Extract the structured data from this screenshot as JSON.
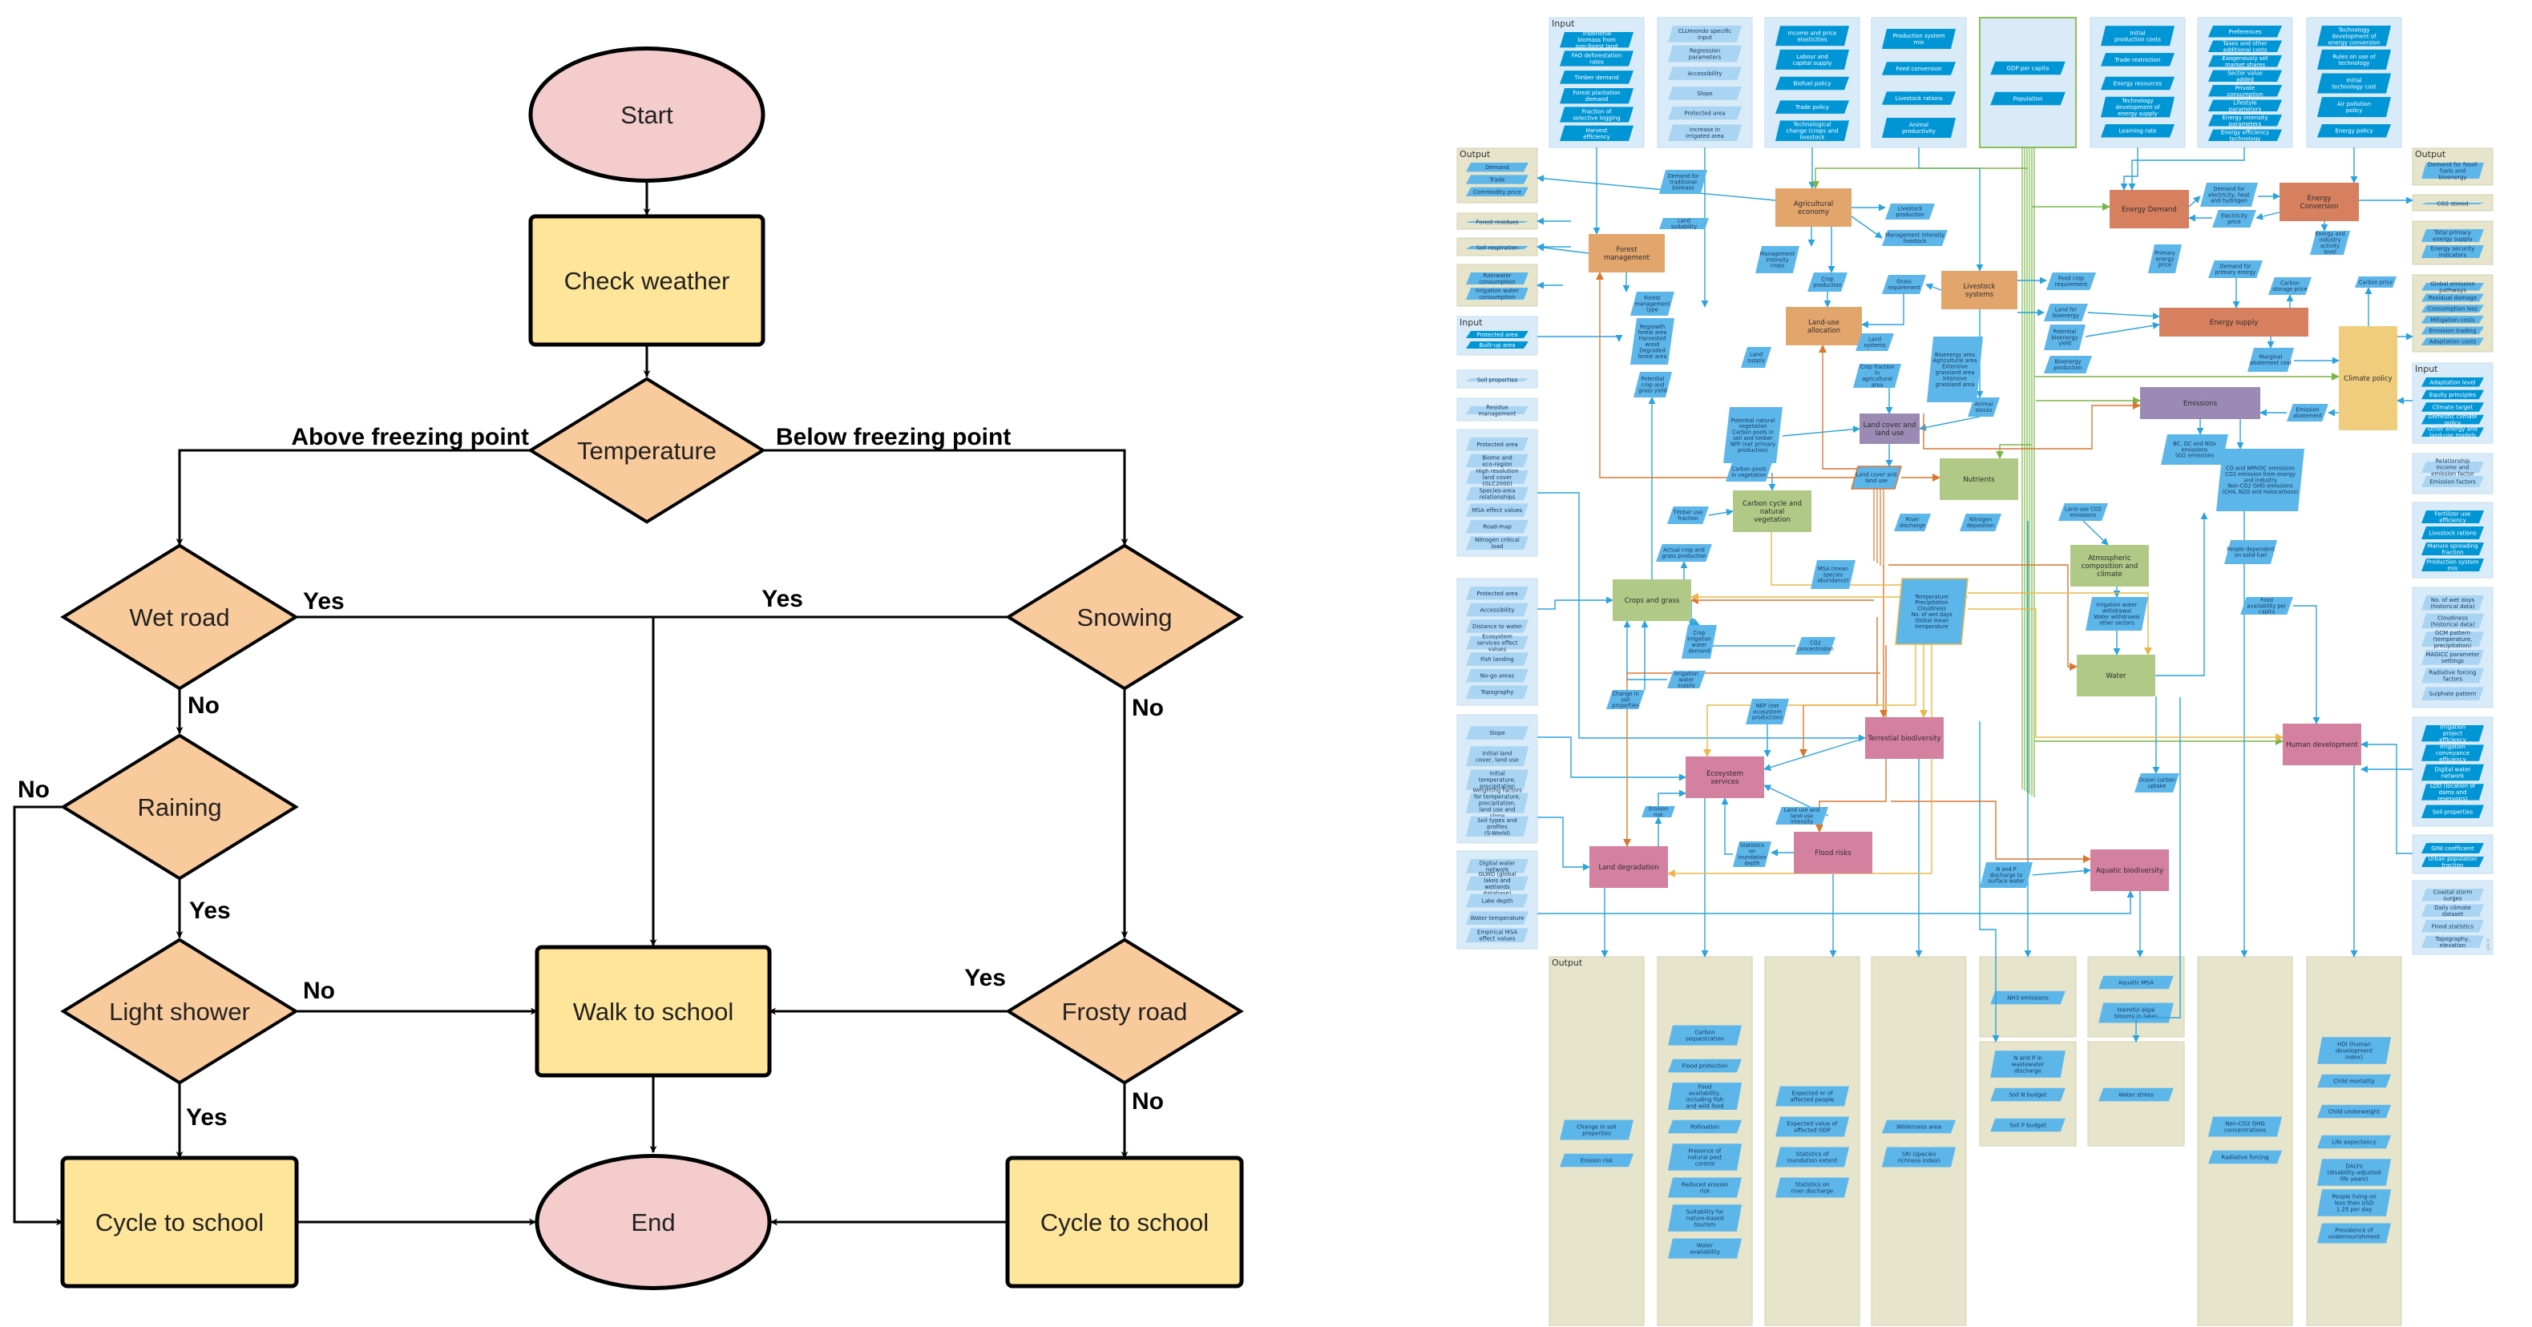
{
  "flowchart": {
    "colors": {
      "terminal": "#f4cccc",
      "process": "#ffe599",
      "decision": "#f9cb9c",
      "stroke": "#000000"
    },
    "nodes": [
      {
        "id": "start",
        "type": "terminal",
        "label": "Start"
      },
      {
        "id": "check_weather",
        "type": "process",
        "label": "Check weather"
      },
      {
        "id": "temperature",
        "type": "decision",
        "label": "Temperature"
      },
      {
        "id": "wet_road",
        "type": "decision",
        "label": "Wet road"
      },
      {
        "id": "snowing",
        "type": "decision",
        "label": "Snowing"
      },
      {
        "id": "raining",
        "type": "decision",
        "label": "Raining"
      },
      {
        "id": "light_shower",
        "type": "decision",
        "label": "Light shower"
      },
      {
        "id": "walk_to_school",
        "type": "process",
        "label": "Walk to school"
      },
      {
        "id": "frosty_road",
        "type": "decision",
        "label": "Frosty road"
      },
      {
        "id": "cycle_left",
        "type": "process",
        "label": "Cycle to school"
      },
      {
        "id": "end",
        "type": "terminal",
        "label": "End"
      },
      {
        "id": "cycle_right",
        "type": "process",
        "label": "Cycle to school"
      }
    ],
    "edges": [
      {
        "from": "start",
        "to": "check_weather",
        "label": ""
      },
      {
        "from": "check_weather",
        "to": "temperature",
        "label": ""
      },
      {
        "from": "temperature",
        "to": "wet_road",
        "label": "Above freezing point"
      },
      {
        "from": "temperature",
        "to": "snowing",
        "label": "Below freezing point"
      },
      {
        "from": "wet_road",
        "to": "walk_to_school",
        "label": "Yes"
      },
      {
        "from": "snowing",
        "to": "walk_to_school",
        "label": "Yes"
      },
      {
        "from": "wet_road",
        "to": "raining",
        "label": "No"
      },
      {
        "from": "snowing",
        "to": "frosty_road",
        "label": "No"
      },
      {
        "from": "raining",
        "to": "cycle_left",
        "label": "No"
      },
      {
        "from": "raining",
        "to": "light_shower",
        "label": "Yes"
      },
      {
        "from": "light_shower",
        "to": "walk_to_school",
        "label": "No"
      },
      {
        "from": "light_shower",
        "to": "cycle_left",
        "label": "Yes"
      },
      {
        "from": "frosty_road",
        "to": "walk_to_school",
        "label": "Yes"
      },
      {
        "from": "frosty_road",
        "to": "cycle_right",
        "label": "No"
      },
      {
        "from": "walk_to_school",
        "to": "end",
        "label": ""
      },
      {
        "from": "cycle_left",
        "to": "end",
        "label": ""
      },
      {
        "from": "cycle_right",
        "to": "end",
        "label": ""
      }
    ]
  },
  "framework": {
    "colors": {
      "input_panel": "#d9ebf8",
      "output_panel": "#e6e4cb",
      "param_dark": "#0096d6",
      "param_mid": "#5db6ea",
      "param_light": "#a9d4f2",
      "arrow": "#2aa3df",
      "agri": "#e2a56c",
      "energy": "#d6805f",
      "emissions": "#9b8bb4",
      "earth_system": "#b0c986",
      "impacts": "#d4809f",
      "climate_policy": "#f0cd7c",
      "drivers_border": "#8cbd5a",
      "orange_flow": "#d9772f",
      "yellow_flow": "#eab84a",
      "green_flow": "#7ab648"
    },
    "panel_titles": {
      "input": "Input",
      "output": "Output"
    },
    "watermark": "pbl.nl",
    "core_modules": [
      {
        "id": "agricultural_economy",
        "label": "Agricultural economy",
        "group": "agri"
      },
      {
        "id": "forest_management",
        "label": "Forest management",
        "group": "agri"
      },
      {
        "id": "livestock_systems",
        "label": "Livestock systems",
        "group": "agri"
      },
      {
        "id": "land_use_allocation",
        "label": "Land-use allocation",
        "group": "agri"
      },
      {
        "id": "energy_demand",
        "label": "Energy Demand",
        "group": "energy"
      },
      {
        "id": "energy_conversion",
        "label": "Energy Conversion",
        "group": "energy"
      },
      {
        "id": "energy_supply",
        "label": "Energy supply",
        "group": "energy"
      },
      {
        "id": "climate_policy",
        "label": "Climate policy",
        "group": "climate_policy"
      },
      {
        "id": "emissions",
        "label": "Emissions",
        "group": "emissions"
      },
      {
        "id": "land_cover_land_use",
        "label": "Land cover and land use",
        "group": "emissions"
      },
      {
        "id": "nutrients",
        "label": "Nutrients",
        "group": "earth_system"
      },
      {
        "id": "carbon_cycle",
        "label": "Carbon cycle and natural vegetation",
        "group": "earth_system"
      },
      {
        "id": "crops_and_grass",
        "label": "Crops and grass",
        "group": "earth_system"
      },
      {
        "id": "atmospheric_composition",
        "label": "Atmospheric composition and climate",
        "group": "earth_system"
      },
      {
        "id": "water",
        "label": "Water",
        "group": "earth_system"
      },
      {
        "id": "terrestrial_biodiversity",
        "label": "Terrestial biodiversity",
        "group": "impacts"
      },
      {
        "id": "ecosystem_services",
        "label": "Ecosystem services",
        "group": "impacts"
      },
      {
        "id": "human_development",
        "label": "Human development",
        "group": "impacts"
      },
      {
        "id": "land_degradation",
        "label": "Land degradation",
        "group": "impacts"
      },
      {
        "id": "flood_risks",
        "label": "Flood risks",
        "group": "impacts"
      },
      {
        "id": "aquatic_biodiversity",
        "label": "Aquatic biodiversity",
        "group": "impacts"
      }
    ],
    "intermediates": [
      {
        "id": "demand_traditional_biomass",
        "label": "Demand for traditional biomass"
      },
      {
        "id": "land_suitability",
        "label": "Land suitability"
      },
      {
        "id": "livestock_production",
        "label": "Livestock production"
      },
      {
        "id": "mgmt_intensity_livestock",
        "label": "Management intensity livestock"
      },
      {
        "id": "mgmt_intensity_crops",
        "label": "Management intensity crops"
      },
      {
        "id": "crop_production",
        "label": "Crop production"
      },
      {
        "id": "grass_requirement",
        "label": "Grass requirement"
      },
      {
        "id": "forest_management_type",
        "label": "Forest management type"
      },
      {
        "id": "regrowth_forest",
        "label": "Regrowth forest area · Harvested wood · Degraded forest area"
      },
      {
        "id": "potential_crop_yield",
        "label": "Potential crop and grass yield"
      },
      {
        "id": "land_supply",
        "label": "Land supply"
      },
      {
        "id": "land_systems",
        "label": "Land systems"
      },
      {
        "id": "crop_fraction",
        "label": "Crop fraction in agricultural area"
      },
      {
        "id": "bioenergy_area",
        "label": "Bioenergy area · Agricultural area · Extensive grassland area · Intensive grassland area"
      },
      {
        "id": "animal_stocks",
        "label": "Animal stocks"
      },
      {
        "id": "feed_crop_requirement",
        "label": "Feed crop requirement"
      },
      {
        "id": "land_for_bioenergy",
        "label": "Land for bioenergy"
      },
      {
        "id": "potential_bioenergy_yield",
        "label": "Potential bioenergy yield"
      },
      {
        "id": "bioenergy_production",
        "label": "Bioenergy production"
      },
      {
        "id": "demand_electricity",
        "label": "Demand for electricity, heat and hydrogen"
      },
      {
        "id": "electricity_price",
        "label": "Electricity price"
      },
      {
        "id": "primary_energy_price",
        "label": "Primary energy price"
      },
      {
        "id": "energy_activity_level",
        "label": "Energy and industry activity level"
      },
      {
        "id": "demand_primary_energy",
        "label": "Demand for primary energy"
      },
      {
        "id": "carbon_storage_price",
        "label": "Carbon storage price"
      },
      {
        "id": "carbon_price",
        "label": "Carbon price"
      },
      {
        "id": "marginal_abatement_cost",
        "label": "Marginal abatement cost"
      },
      {
        "id": "emission_abatement",
        "label": "Emission abatement"
      },
      {
        "id": "bc_oc_nox",
        "label": "BC, OC and NOx emissions · SO2 emissions"
      },
      {
        "id": "co_nmvoc",
        "label": "CO and NMVOC emissions · CO2 emission from energy and industry · Non-CO2 GHG emissions (CH4, N2O and Halocarbons)"
      },
      {
        "id": "potential_natural_vegetation",
        "label": "Potential natural vegetation · Carbon pools in soil and timber · NPP (net primary production)"
      },
      {
        "id": "carbon_pools_vegetation",
        "label": "Carbon pools in vegetation"
      },
      {
        "id": "land_cover_param",
        "label": "Land cover and land use"
      },
      {
        "id": "timber_use_fraction",
        "label": "Timber use fraction"
      },
      {
        "id": "river_discharge",
        "label": "River discharge"
      },
      {
        "id": "nitrogen_deposition",
        "label": "Nitrogen deposition"
      },
      {
        "id": "landuse_co2",
        "label": "Land-use CO2 emissions"
      },
      {
        "id": "people_solid_fuel",
        "label": "People dependent on solid fuel"
      },
      {
        "id": "actual_crop_production",
        "label": "Actual crop and grass production"
      },
      {
        "id": "msa",
        "label": "MSA (mean species abundance)"
      },
      {
        "id": "climate_vars",
        "label": "Temperature · Precipitation · Cloudiness · No. of wet days · Global mean temperature"
      },
      {
        "id": "food_availability",
        "label": "Food availability per capita"
      },
      {
        "id": "crop_irrigation_demand",
        "label": "Crop irrigation water demand"
      },
      {
        "id": "co2_concentration",
        "label": "CO2 concentration"
      },
      {
        "id": "irrigation_withdrawal",
        "label": "Irrigation water withdrawal · Water withdrawal other sectors"
      },
      {
        "id": "irrigation_supply",
        "label": "Irrigation water supply"
      },
      {
        "id": "change_soil_properties",
        "label": "Change in soil properties"
      },
      {
        "id": "nep",
        "label": "NEP (net ecosystem production)"
      },
      {
        "id": "ocean_carbon_uptake",
        "label": "Ocean carbon uptake"
      },
      {
        "id": "erosion_risk",
        "label": "Erosion risk"
      },
      {
        "id": "land_use_intensity",
        "label": "Land use and land-use intensity"
      },
      {
        "id": "statistics_inundation_depth",
        "label": "Statistics on inundation depth"
      },
      {
        "id": "n_p_discharge",
        "label": "N and P discharge to surface water"
      }
    ],
    "top_inputs": [
      {
        "items": [
          "Traditional biomass from non-forest land",
          "FAO deforestation rates",
          "Timber demand",
          "Forest plantation demand",
          "Fraction of selective logging",
          "Harvest efficiency"
        ]
      },
      {
        "items": [
          "CLUmondo specific input",
          "Regression parameters",
          "Accessibility",
          "Slope",
          "Protected area",
          "Increase in irrigated area"
        ]
      },
      {
        "items": [
          "Income and price elasticities",
          "Labour and capital supply",
          "Biofuel policy",
          "Trade policy",
          "Technological change (crops and livestock"
        ]
      },
      {
        "items": [
          "Production system mix",
          "Feed conversion",
          "Livestock rations",
          "Animal productivity"
        ]
      },
      {
        "items": [
          "GDP per capita",
          "Population"
        ]
      },
      {
        "items": [
          "Initial production costs",
          "Trade restriction",
          "Energy resources",
          "Technology development of energy supply",
          "Learning rate"
        ]
      },
      {
        "items": [
          "Preferences",
          "Taxes and other additional costs",
          "Exogenously set market shares",
          "Sector value added",
          "Private consumption",
          "Lifestyle parameters",
          "Energy intensity parameters",
          "Energy efficiency technology"
        ]
      },
      {
        "items": [
          "Technology development of energy conversion",
          "Rules on use of technology",
          "Initial technology cost",
          "Air pollution policy",
          "Energy policy"
        ]
      }
    ],
    "left_outputs": [
      {
        "items": [
          "Demand",
          "Trade",
          "Commodity price"
        ]
      },
      {
        "items": [
          "Forest residues"
        ]
      },
      {
        "items": [
          "Soil respiration"
        ]
      },
      {
        "items": [
          "Rainwater consumption",
          "Irrigation water consumption"
        ]
      }
    ],
    "left_inputs": [
      {
        "items": [
          "Protected area",
          "Built-up area"
        ]
      },
      {
        "items": [
          "Soil properties"
        ]
      },
      {
        "items": [
          "Residue management"
        ]
      },
      {
        "items": [
          "Protected area",
          "Biome and eco-region",
          "High resolution land cover (GLC2000)",
          "Species-area relationships",
          "MSA effect values",
          "Road-map",
          "Nitrogen critical load"
        ]
      },
      {
        "items": [
          "Protected area",
          "Accessibility",
          "Distance to water",
          "Ecosystem services effect values",
          "Fish landing",
          "No-go areas",
          "Topography"
        ]
      },
      {
        "items": [
          "Slope",
          "Initial land cover, land use",
          "Initial temperature, precipitation",
          "Weighting factors for temperature, precipitation, land use and slope",
          "Soil types and profiles (S-World)"
        ]
      },
      {
        "items": [
          "Digital water network",
          "GLWD (global lakes and wetlands database)",
          "Lake depth",
          "Water temperature",
          "Empirical MSA effect values"
        ]
      }
    ],
    "right_outputs": [
      {
        "items": [
          "Demand for fossil fuels and bioenergy"
        ]
      },
      {
        "items": [
          "CO2 stored"
        ]
      },
      {
        "items": [
          "Total primary energy supply",
          "Energy security indicators"
        ]
      },
      {
        "items": [
          "Global emission pathways",
          "Residual damage",
          "Consumption loss",
          "Mitigation costs",
          "Emission trading",
          "Adaptation costs"
        ]
      }
    ],
    "right_inputs": [
      {
        "items": [
          "Adaptation level",
          "Equity principles",
          "Climate target",
          "Domestic climate policy",
          "Other energy and land-use models"
        ]
      },
      {
        "items": [
          "Relationship income and emission factor",
          "Emission factors"
        ]
      },
      {
        "items": [
          "Fertilizer use efficiency",
          "Livestock rations",
          "Manure spreading fraction",
          "Production system mix"
        ]
      },
      {
        "items": [
          "No. of wet days (historical data)",
          "Cloudiness (historical data)",
          "GCM pattern (temperature, precipitation)",
          "MAGICC parameter settings",
          "Radiative forcing factors",
          "Sulphate pattern"
        ]
      },
      {
        "items": [
          "Irrigation project efficiency",
          "Irrigation conveyance efficiency",
          "Digital water network",
          "LOD (location of dams and reservoirs)",
          "Soil properties"
        ]
      },
      {
        "items": [
          "GINI coefficient",
          "Urban population fraction"
        ]
      },
      {
        "items": [
          "Coastal storm surges",
          "Daily climate dataset",
          "Flood statistics",
          "Topography, elevation"
        ]
      }
    ],
    "bottom_outputs": [
      {
        "items": [
          "Change in soil properties",
          "Erosion risk"
        ]
      },
      {
        "items": [
          "Carbon sequestration",
          "Flood protection",
          "Food availability, including fish and wild food",
          "Pollination",
          "Presence of natural pest control",
          "Reduced erosion risk",
          "Suitability for nature-based tourism",
          "Water availability"
        ]
      },
      {
        "items": [
          "Expected nr of affected people",
          "Expected value of affected GDP",
          "Statistics of inundation extent",
          "Statistics on river discharge"
        ]
      },
      {
        "items": [
          "Wilderness area",
          "SRI (species richness index)"
        ]
      },
      {
        "items": [
          "NH3 emissions"
        ]
      },
      {
        "items": [
          "N and P in wastewater discharge",
          "Soil N budget",
          "Soil P budget"
        ]
      },
      {
        "items": [
          "Aquatic MSA",
          "Harmful algal blooms in lakes"
        ]
      },
      {
        "items": [
          "Water stress"
        ]
      },
      {
        "items": [
          "Non-CO2 GHG concentrations",
          "Radiative forcing"
        ]
      },
      {
        "items": [
          "HDI (human development index)",
          "Child mortality",
          "Child underweight",
          "Life expectancy",
          "DALYs (disability-adjusted life years)",
          "People living on less then USD 1.25 per day",
          "Prevalence of undernourishment"
        ]
      }
    ]
  }
}
